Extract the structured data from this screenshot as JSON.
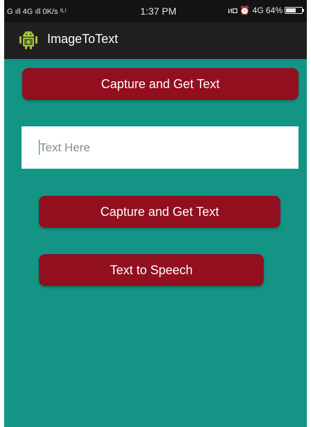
{
  "status_bar": {
    "left_text": "G ıll 4G ıll 0K/s ⁽ᴸ⁾",
    "time": "1:37 PM",
    "right_text": "ᴎ◘ ⏰ 4G 64%",
    "battery_percent": 64
  },
  "app_bar": {
    "title": "ImageToText",
    "icon": "android-icon"
  },
  "main": {
    "capture_button_top_label": "Capture and Get Text",
    "text_input": {
      "value": "",
      "placeholder": "Text Here"
    },
    "capture_button_label": "Capture and Get Text",
    "tts_button_label": "Text to Speech"
  },
  "colors": {
    "background": "#139484",
    "button": "#920f1f",
    "status_bar": "#141414",
    "action_bar": "#202020",
    "android_green": "#a4c639"
  }
}
